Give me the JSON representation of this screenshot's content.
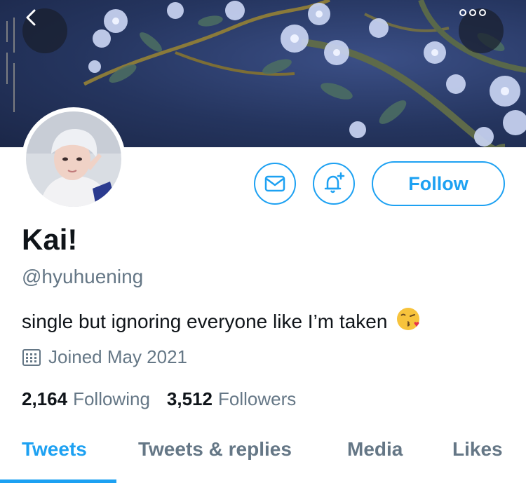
{
  "header": {
    "back_icon": "chevron-left-icon",
    "more_icon": "more-horizontal-icon"
  },
  "profile": {
    "name": "Kai!",
    "handle": "@hyuhuening",
    "bio": "single but ignoring everyone like I’m taken",
    "bio_emoji": "😘",
    "joined": "Joined May 2021",
    "following_count": "2,164",
    "following_label": "Following",
    "followers_count": "3,512",
    "followers_label": "Followers"
  },
  "actions": {
    "message_icon": "mail-icon",
    "notify_icon": "bell-plus-icon",
    "follow_label": "Follow"
  },
  "tabs": [
    {
      "label": "Tweets",
      "active": true
    },
    {
      "label": "Tweets & replies",
      "active": false
    },
    {
      "label": "Media",
      "active": false
    },
    {
      "label": "Likes",
      "active": false
    }
  ],
  "colors": {
    "accent": "#1da1f2",
    "secondary_text": "#657786",
    "primary_text": "#0f1419"
  }
}
